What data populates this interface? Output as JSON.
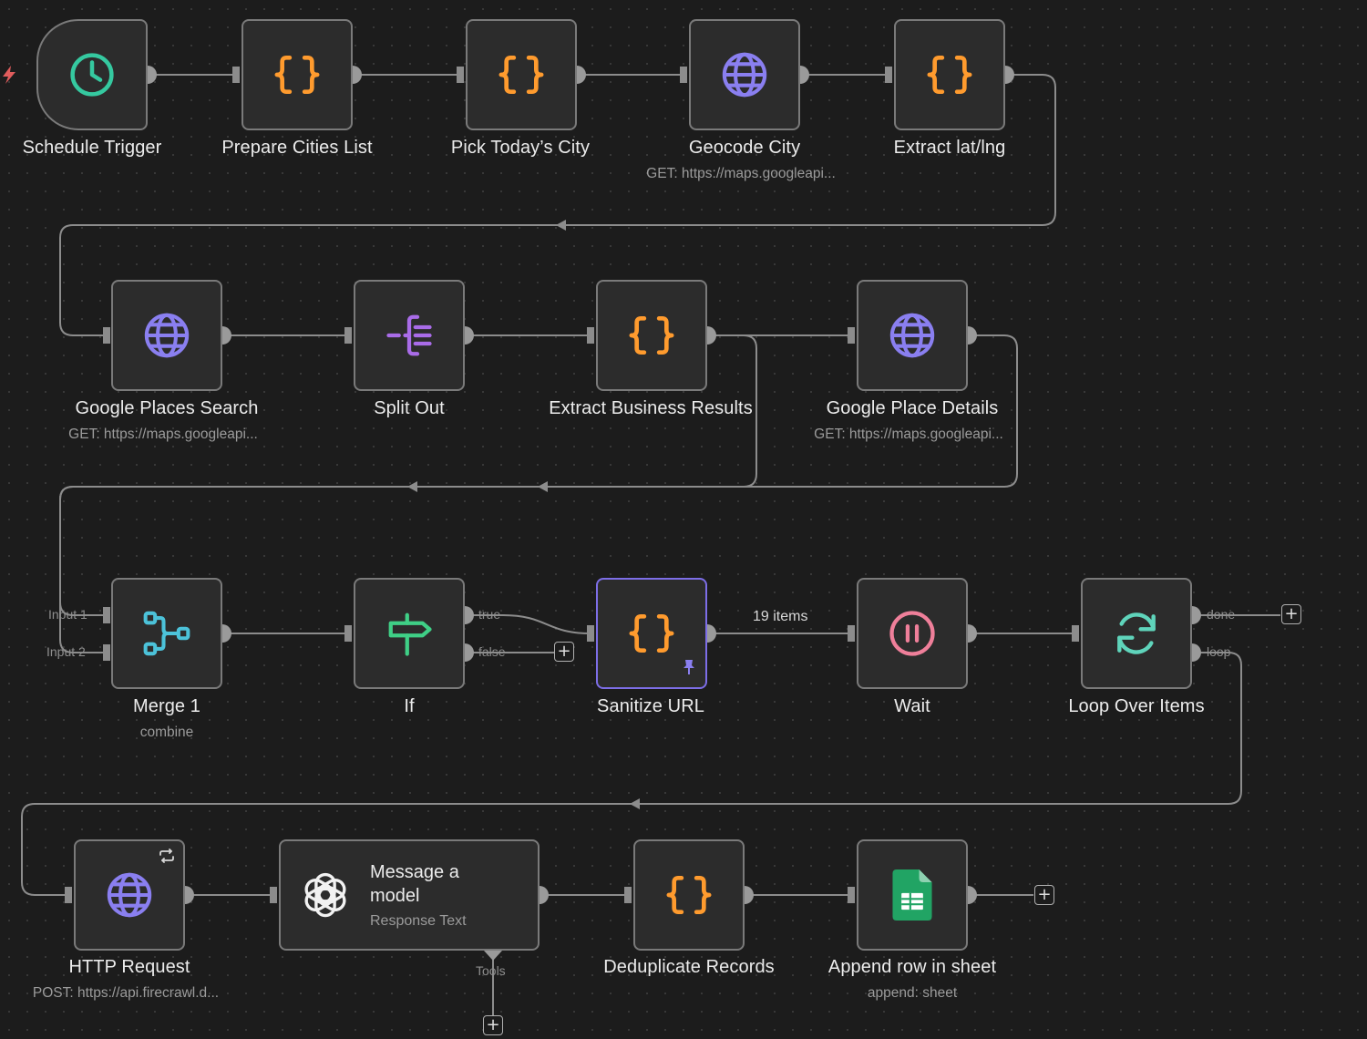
{
  "nodes": {
    "schedule_trigger": {
      "label": "Schedule Trigger",
      "icon": "clock-icon"
    },
    "prepare_cities": {
      "label": "Prepare Cities List",
      "icon": "code-braces-icon"
    },
    "pick_city": {
      "label": "Pick Today’s City",
      "icon": "code-braces-icon"
    },
    "geocode_city": {
      "label": "Geocode City",
      "sub": "GET: https://maps.googleapi...",
      "icon": "globe-icon"
    },
    "extract_latlng": {
      "label": "Extract lat/lng",
      "icon": "code-braces-icon"
    },
    "places_search": {
      "label": "Google Places Search",
      "sub": "GET: https://maps.googleapi...",
      "icon": "globe-icon"
    },
    "split_out": {
      "label": "Split Out",
      "icon": "split-out-icon"
    },
    "extract_business": {
      "label": "Extract Business Results",
      "icon": "code-braces-icon"
    },
    "place_details": {
      "label": "Google Place Details",
      "sub": "GET: https://maps.googleapi...",
      "icon": "globe-icon"
    },
    "merge": {
      "label": "Merge 1",
      "sub": "combine",
      "icon": "merge-icon",
      "inputs": [
        "Input 1",
        "Input 2"
      ]
    },
    "if_node": {
      "label": "If",
      "icon": "signpost-icon",
      "outputs": [
        "true",
        "false"
      ]
    },
    "sanitize": {
      "label": "Sanitize URL",
      "icon": "code-braces-icon",
      "pinned": true
    },
    "wait": {
      "label": "Wait",
      "icon": "pause-icon"
    },
    "loop": {
      "label": "Loop Over Items",
      "icon": "refresh-icon",
      "outputs": [
        "done",
        "loop"
      ]
    },
    "http_request": {
      "label": "HTTP Request",
      "sub": "POST: https://api.firecrawl.d...",
      "icon": "globe-icon"
    },
    "message_model": {
      "title": "Message a model",
      "sub": "Response Text",
      "icon": "openai-icon",
      "tools_label": "Tools"
    },
    "dedupe": {
      "label": "Deduplicate Records",
      "icon": "code-braces-icon"
    },
    "append_row": {
      "label": "Append row in sheet",
      "sub": "append: sheet",
      "icon": "google-sheets-icon"
    }
  },
  "edges": {
    "sanitize_to_wait": "19 items"
  },
  "colors": {
    "background": "#1c1c1c",
    "node_fill": "#2c2c2c",
    "node_border": "#7a7a7a",
    "selected_border": "#7d6ee7",
    "code": "#ff9b2e",
    "http": "#8a7ff0",
    "trigger": "#35c9a0",
    "merge": "#4cc2d9",
    "if": "#3fcf86",
    "wait": "#ef7f9a",
    "sheets": "#21a464",
    "wire": "#8c8c8c"
  }
}
